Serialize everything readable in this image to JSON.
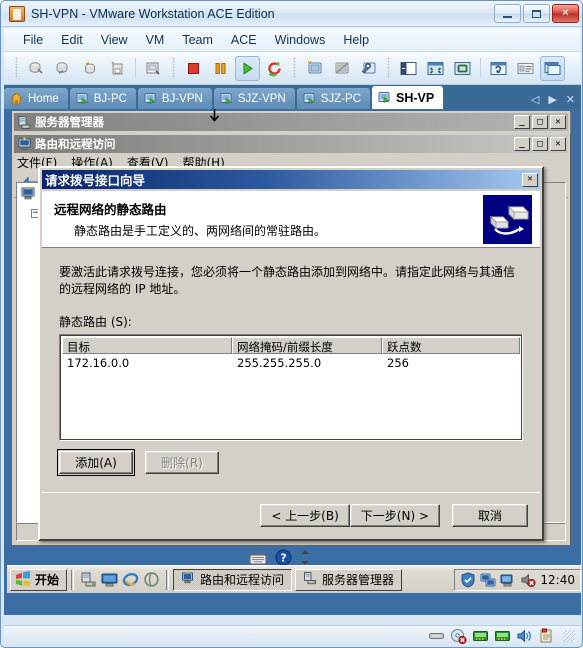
{
  "vmware": {
    "title": "SH-VPN - VMware Workstation ACE Edition",
    "app_icon": "vmware-icon",
    "window_buttons": [
      {
        "name": "minimize-button",
        "glyph": "minimize-icon"
      },
      {
        "name": "maximize-button",
        "glyph": "maximize-icon"
      },
      {
        "name": "close-button",
        "glyph": "close-icon",
        "label": "✕"
      }
    ],
    "menu": [
      "File",
      "Edit",
      "View",
      "VM",
      "Team",
      "ACE",
      "Windows",
      "Help"
    ],
    "toolbar_groups": [
      [
        "snapshot-take-icon",
        "snapshot-revert-icon",
        "snapshot-manager-icon",
        "snapshot-delete-icon",
        "separator",
        "teams-icon"
      ],
      [
        "power-off-icon",
        "suspend-icon",
        "power-on-icon",
        "reset-icon"
      ],
      [
        "new-vm-icon",
        "clone-vm-icon",
        "vm-settings-icon"
      ],
      [
        "show-sidebar-icon",
        "fullscreen-icon",
        "quick-switch-icon",
        "separator",
        "preferences-icon",
        "summary-view-icon",
        "console-view-icon"
      ]
    ],
    "tabs": [
      {
        "label": "Home",
        "icon": "home-icon",
        "active": false
      },
      {
        "label": "BJ-PC",
        "icon": "vm-icon",
        "active": false
      },
      {
        "label": "BJ-VPN",
        "icon": "vm-icon",
        "active": false
      },
      {
        "label": "SJZ-VPN",
        "icon": "vm-icon",
        "active": false
      },
      {
        "label": "SJZ-PC",
        "icon": "vm-icon",
        "active": false
      },
      {
        "label": "SH-VP",
        "icon": "vm-icon",
        "active": true
      }
    ],
    "tab_nav": {
      "prev": "◁",
      "next": "▶",
      "close": "✕"
    },
    "status_icons": [
      "hard-disk-icon",
      "cdrom-disconnected-icon",
      "network-adapter-1-icon",
      "network-adapter-2-icon",
      "sound-icon",
      "usb-device-icon"
    ]
  },
  "server_manager_window": {
    "title": "服务器管理器",
    "icon": "server-manager-icon",
    "buttons": {
      "minimize": "_",
      "maximize": "□",
      "close": "✕"
    }
  },
  "rras_window": {
    "title": "路由和远程访问",
    "icon": "rras-icon",
    "buttons": {
      "minimize": "_",
      "maximize": "□",
      "close": "✕"
    },
    "menu": [
      "文件(F)",
      "操作(A)",
      "查看(V)",
      "帮助(H)"
    ],
    "toolbar_icons": [
      "back-arrow-icon"
    ],
    "tree_nodes": [
      {
        "name": "server-status-node",
        "icon": "server-icon",
        "expander": null
      },
      {
        "name": "server-node",
        "icon": null,
        "expander": "−"
      }
    ],
    "status_cells": [
      "",
      "",
      ""
    ]
  },
  "wizard": {
    "title": "请求拨号接口向导",
    "close_label": "✕",
    "header": {
      "title": "远程网络的静态路由",
      "subtitle": "静态路由是手工定义的、两网络间的常驻路由。",
      "icon": "network-route-icon"
    },
    "intro": "要激活此请求拨号连接，您必须将一个静态路由添加到网络中。请指定此网络与其通信的远程网络的 IP 地址。",
    "list_label": "静态路由 (S):",
    "table": {
      "columns": [
        "目标",
        "网络掩码/前缀长度",
        "跃点数"
      ],
      "rows": [
        [
          "172.16.0.0",
          "255.255.255.0",
          "256"
        ]
      ]
    },
    "list_buttons": [
      {
        "label": "添加(A)",
        "name": "add-route-button",
        "state": "default"
      },
      {
        "label": "删除(R)",
        "name": "delete-route-button",
        "state": "disabled"
      }
    ],
    "footer_buttons": [
      {
        "label": "< 上一步(B)",
        "name": "back-button",
        "state": "normal"
      },
      {
        "label": "下一步(N) >",
        "name": "next-button",
        "state": "normal"
      },
      {
        "label": "取消",
        "name": "cancel-button",
        "state": "normal"
      }
    ]
  },
  "taskbar": {
    "start_label": "开始",
    "start_icon": "windows-flag-icon",
    "quick_launch": [
      "server-manager-small-icon",
      "show-desktop-icon",
      "internet-explorer-icon",
      "ie-alt-icon"
    ],
    "tasks": [
      {
        "label": "路由和远程访问",
        "icon": "rras-icon",
        "active": true
      },
      {
        "label": "服务器管理器",
        "icon": "server-manager-icon",
        "active": false
      }
    ],
    "tray_icons": [
      "security-shield-icon",
      "network-icon",
      "network-status-icon",
      "volume-muted-icon"
    ],
    "clock": "12:40"
  }
}
